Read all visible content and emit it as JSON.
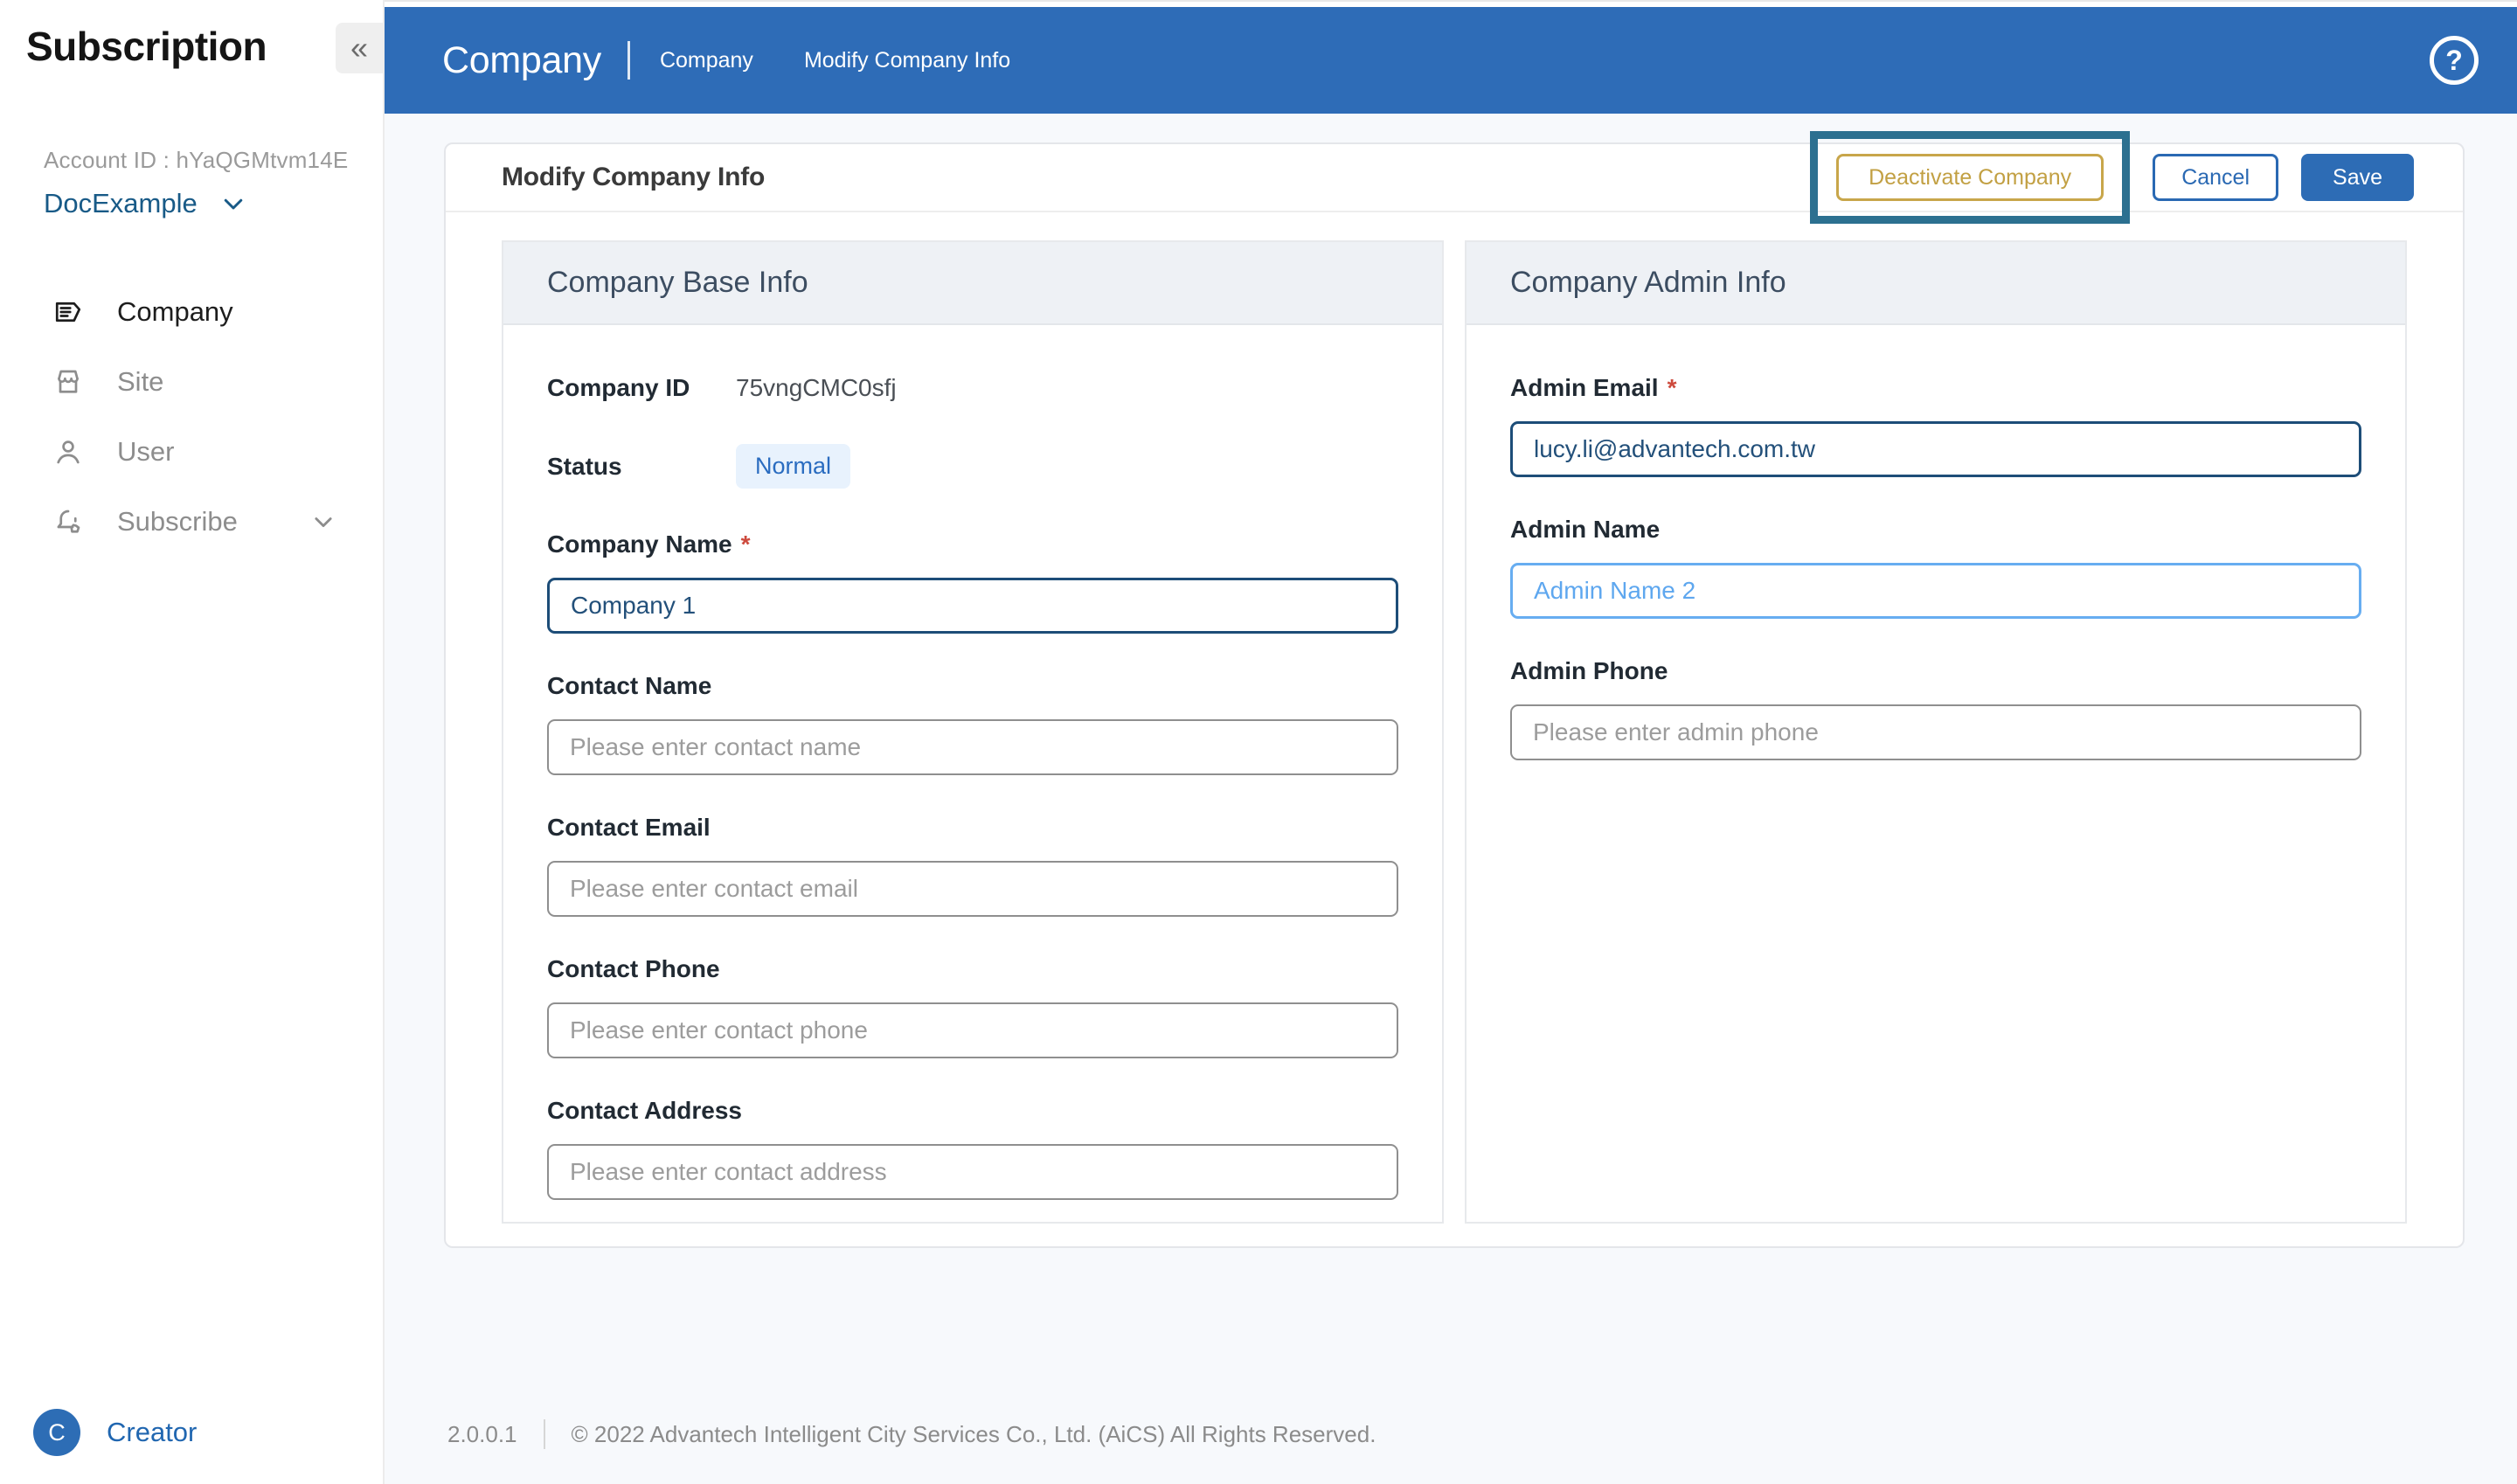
{
  "sidebar": {
    "logo": "Subscription",
    "collapse_icon": "«",
    "account_id": "Account ID : hYaQGMtvm14E",
    "account_name": "DocExample",
    "menu": [
      {
        "label": "Company",
        "icon": "company-tag-icon",
        "active": true
      },
      {
        "label": "Site",
        "icon": "site-storefront-icon",
        "active": false
      },
      {
        "label": "User",
        "icon": "user-icon",
        "active": false
      },
      {
        "label": "Subscribe",
        "icon": "subscribe-bell-icon",
        "active": false,
        "expandable": true
      }
    ],
    "creator": {
      "initial": "C",
      "label": "Creator"
    }
  },
  "header": {
    "title": "Company",
    "breadcrumbs": [
      "Company",
      "Modify Company Info"
    ],
    "help_icon": "question-mark"
  },
  "page": {
    "title": "Modify Company Info",
    "actions": {
      "deactivate": "Deactivate Company",
      "cancel": "Cancel",
      "save": "Save"
    }
  },
  "misc": {
    "required_mark": "*"
  },
  "base_info": {
    "title": "Company Base Info",
    "company_id": {
      "label": "Company ID",
      "value": "75vngCMC0sfj"
    },
    "status": {
      "label": "Status",
      "value": "Normal"
    },
    "fields": [
      {
        "label": "Company Name",
        "required": true,
        "value": "Company 1"
      },
      {
        "label": "Contact Name",
        "placeholder": "Please enter contact name"
      },
      {
        "label": "Contact Email",
        "placeholder": "Please enter contact email"
      },
      {
        "label": "Contact Phone",
        "placeholder": "Please enter contact phone"
      },
      {
        "label": "Contact Address",
        "placeholder": "Please enter contact address"
      }
    ]
  },
  "admin_info": {
    "title": "Company Admin Info",
    "fields": [
      {
        "label": "Admin Email",
        "required": true,
        "value": "lucy.li@advantech.com.tw"
      },
      {
        "label": "Admin Name",
        "value": "Admin Name 2",
        "state": "highlighted"
      },
      {
        "label": "Admin Phone",
        "placeholder": "Please enter admin phone"
      }
    ]
  },
  "footer": {
    "version": "2.0.0.1",
    "copyright": "© 2022 Advantech Intelligent City Services Co., Ltd. (AiCS) All Rights Reserved."
  },
  "colors": {
    "header_blue": "#2e6cb7",
    "save_blue": "#2d6cb5",
    "gold_outline": "#c8a64a",
    "annotation_teal": "#2c7090",
    "badge_bg": "#e8f2fd",
    "badge_text": "#2a6cc0",
    "navy_input": "#1d4d78",
    "highlight_input": "#67adf1",
    "page_bg": "#f7f9fc"
  }
}
